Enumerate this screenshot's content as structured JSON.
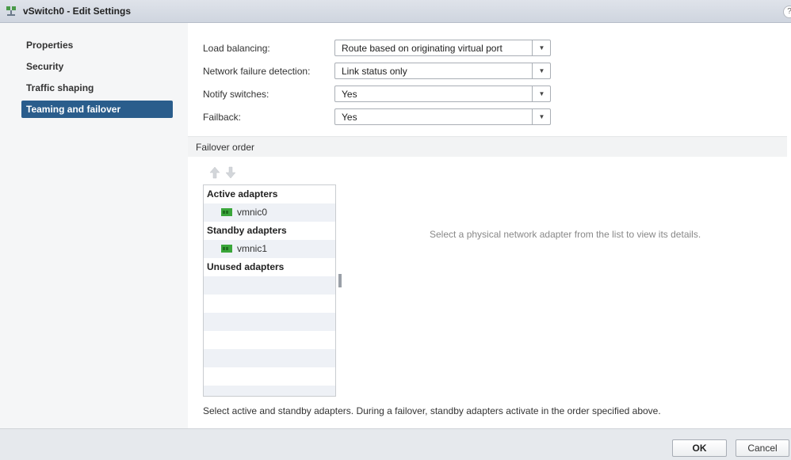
{
  "window": {
    "title": "vSwitch0 - Edit Settings",
    "help_label": "?"
  },
  "nav": {
    "items": [
      {
        "label": "Properties"
      },
      {
        "label": "Security"
      },
      {
        "label": "Traffic shaping"
      },
      {
        "label": "Teaming and failover",
        "active": true
      }
    ]
  },
  "settings": {
    "load_balancing": {
      "label": "Load balancing:",
      "value": "Route based on originating virtual port"
    },
    "failure_detection": {
      "label": "Network failure detection:",
      "value": "Link status only"
    },
    "notify_switches": {
      "label": "Notify switches:",
      "value": "Yes"
    },
    "failback": {
      "label": "Failback:",
      "value": "Yes"
    }
  },
  "failover": {
    "header": "Failover order",
    "move_up_icon": "arrow-up-icon",
    "move_down_icon": "arrow-down-icon",
    "groups": {
      "active": {
        "label": "Active adapters",
        "adapters": [
          "vmnic0"
        ]
      },
      "standby": {
        "label": "Standby adapters",
        "adapters": [
          "vmnic1"
        ]
      },
      "unused": {
        "label": "Unused adapters",
        "adapters": []
      }
    },
    "details_hint": "Select a physical network adapter from the list to view its details.",
    "footer_note": "Select active and standby adapters. During a failover, standby adapters activate in the order specified above."
  },
  "buttons": {
    "ok": "OK",
    "cancel": "Cancel"
  },
  "colors": {
    "accent": "#2a5d8c",
    "nic_icon": "#3aa63a",
    "stripe": "#eef1f6"
  }
}
